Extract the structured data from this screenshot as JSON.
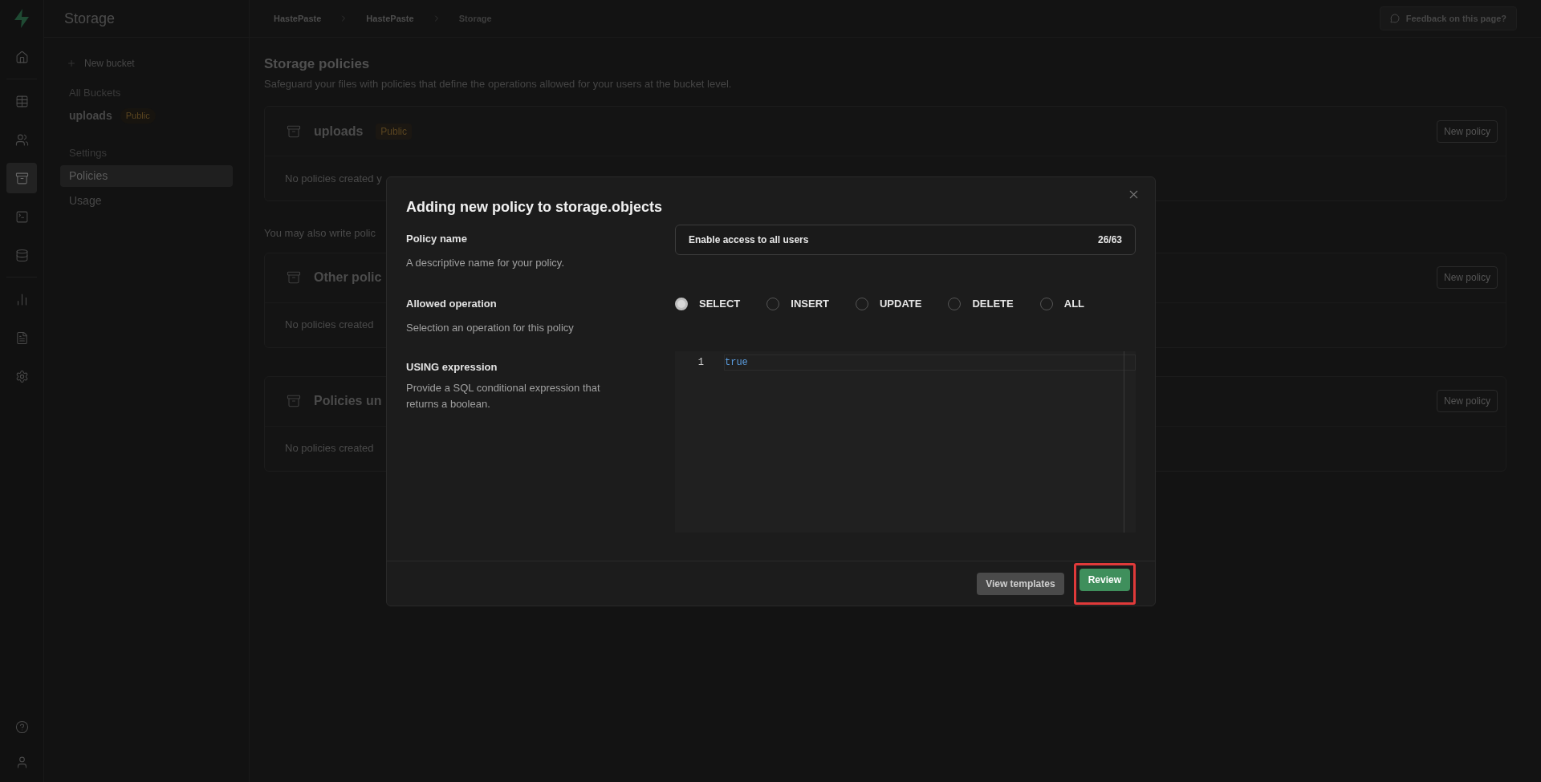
{
  "rail": [
    {
      "kind": "home",
      "selected": false
    },
    {
      "kind": "table",
      "selected": false
    },
    {
      "kind": "users",
      "selected": false
    },
    {
      "kind": "archive",
      "selected": true
    },
    {
      "kind": "terminal",
      "selected": false
    },
    {
      "kind": "database",
      "selected": false
    },
    {
      "kind": "chart",
      "selected": false
    },
    {
      "kind": "file",
      "selected": false
    },
    {
      "kind": "settings",
      "selected": false
    }
  ],
  "rail_bottom": [
    {
      "kind": "help"
    },
    {
      "kind": "user"
    }
  ],
  "sidebar": {
    "title": "Storage",
    "new_bucket": "New bucket",
    "sections": [
      {
        "heading": "All Buckets",
        "items": [
          {
            "label": "uploads",
            "badge": "Public",
            "selected": false
          }
        ]
      },
      {
        "heading": "Settings",
        "items": [
          {
            "label": "Policies",
            "selected": true
          },
          {
            "label": "Usage",
            "selected": false
          }
        ]
      }
    ]
  },
  "breadcrumbs": [
    "HastePaste",
    "HastePaste",
    "Storage"
  ],
  "feedback_button": "Feedback on this page?",
  "page": {
    "title": "Storage policies",
    "subtitle": "Safeguard your files with policies that define the operations allowed for your users at the bucket level.",
    "cards": [
      {
        "title": "uploads",
        "badge": "Public",
        "empty_text": "No policies created y",
        "button": "New policy"
      }
    ],
    "note": "You may also write polic",
    "more_cards": [
      {
        "title": "Other polic",
        "empty_text": "No policies created",
        "button": "New policy"
      },
      {
        "title": "Policies un",
        "empty_text": "No policies created",
        "button": "New policy"
      }
    ]
  },
  "dialog": {
    "title": "Adding new policy to storage.objects",
    "policy_name": {
      "label": "Policy name",
      "description": "A descriptive name for your policy.",
      "value": "Enable access to all users",
      "counter": "26/63"
    },
    "operation": {
      "label": "Allowed operation",
      "description": "Selection an operation for this policy",
      "options": [
        {
          "label": "SELECT",
          "selected": true
        },
        {
          "label": "INSERT",
          "selected": false
        },
        {
          "label": "UPDATE",
          "selected": false
        },
        {
          "label": "DELETE",
          "selected": false
        },
        {
          "label": "ALL",
          "selected": false
        }
      ]
    },
    "expression": {
      "label": "USING expression",
      "description": "Provide a SQL conditional expression that returns a boolean.",
      "lines": [
        {
          "number": "1",
          "code": "true"
        }
      ]
    },
    "buttons": [
      {
        "label": "View templates",
        "kind": "secondary",
        "highlighted": false
      },
      {
        "label": "Review",
        "kind": "primary",
        "highlighted": true
      }
    ]
  }
}
